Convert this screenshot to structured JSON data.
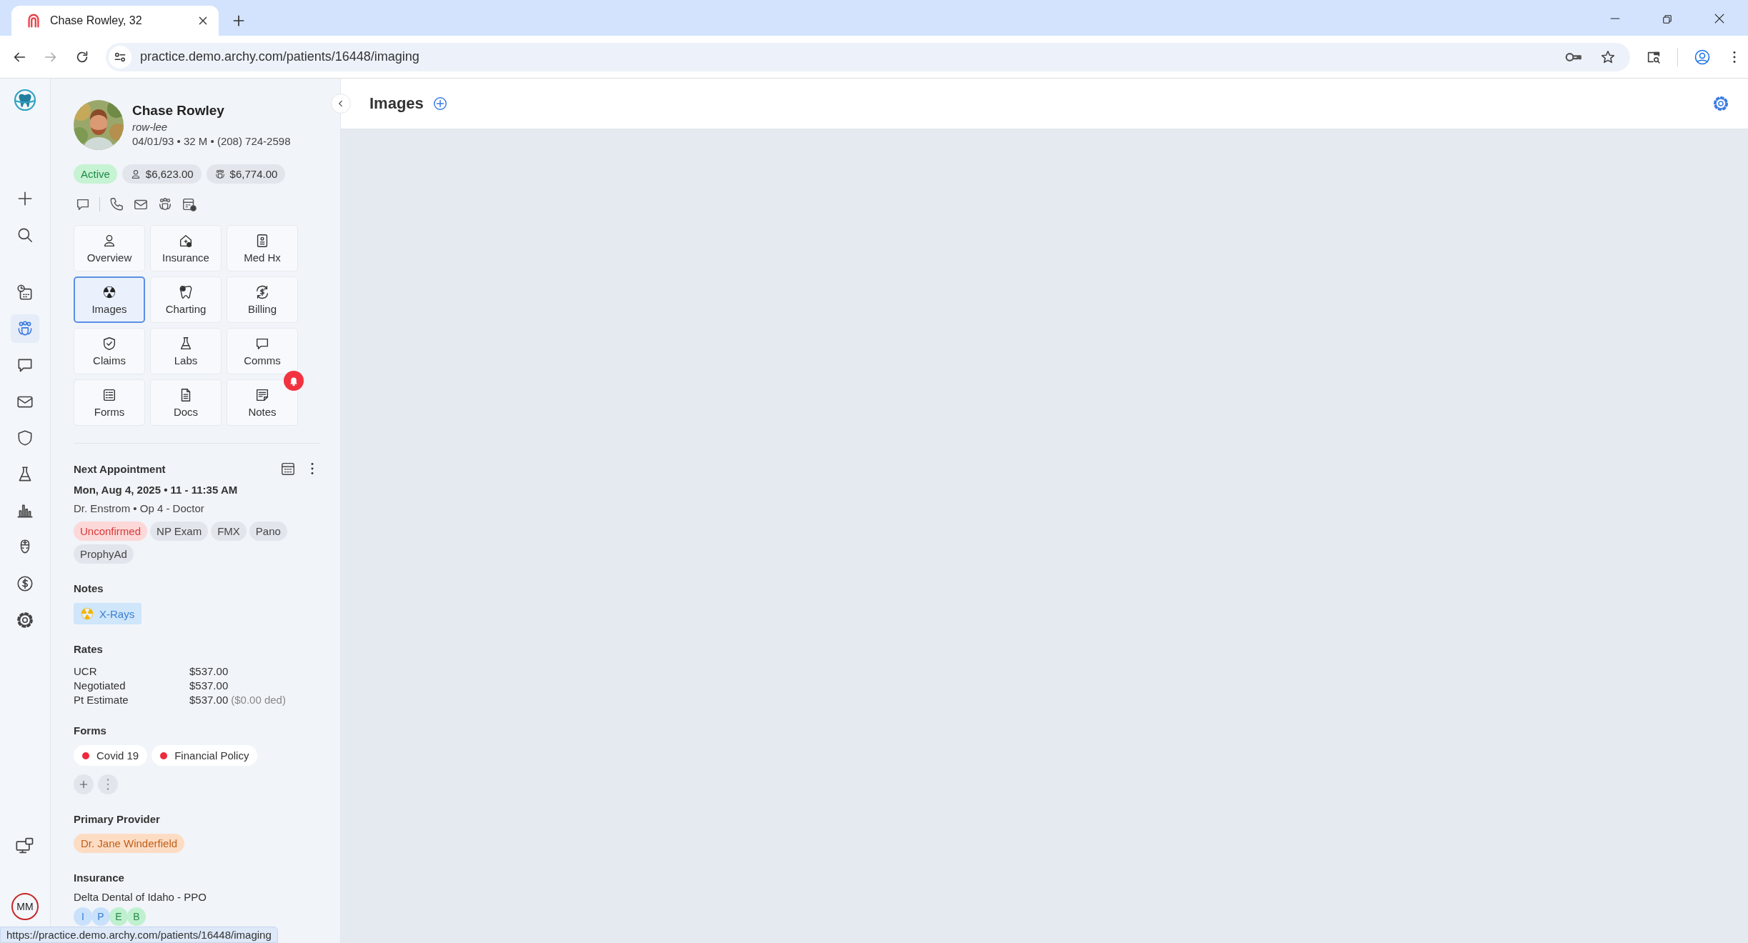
{
  "browser": {
    "tab_title": "Chase Rowley, 32",
    "url": "practice.demo.archy.com/patients/16448/imaging",
    "status_url": "https://practice.demo.archy.com/patients/16448/imaging"
  },
  "rail": {
    "items": [
      {
        "kind": "add",
        "selected": false
      },
      {
        "kind": "search",
        "selected": false
      },
      {
        "kind": "schedule",
        "selected": false
      },
      {
        "kind": "patients",
        "selected": true
      },
      {
        "kind": "chat",
        "selected": false
      },
      {
        "kind": "mail",
        "selected": false
      },
      {
        "kind": "shield",
        "selected": false
      },
      {
        "kind": "lab",
        "selected": false
      },
      {
        "kind": "reports",
        "selected": false
      },
      {
        "kind": "staff",
        "selected": false
      },
      {
        "kind": "billing",
        "selected": false
      },
      {
        "kind": "settings",
        "selected": false
      }
    ],
    "user_initials": "MM"
  },
  "patient": {
    "name": "Chase Rowley",
    "pronunciation": "row-lee",
    "details": "04/01/93 • 32 M • (208) 724-2598",
    "status": "Active",
    "balances": [
      {
        "kind": "patient",
        "amount": "$6,623.00"
      },
      {
        "kind": "family",
        "amount": "$6,774.00"
      }
    ],
    "tiles": [
      {
        "kind": "overview",
        "label": "Overview",
        "selected": false,
        "alert": false
      },
      {
        "kind": "insurance",
        "label": "Insurance",
        "selected": false,
        "alert": false
      },
      {
        "kind": "medhx",
        "label": "Med Hx",
        "selected": false,
        "alert": false
      },
      {
        "kind": "images",
        "label": "Images",
        "selected": true,
        "alert": false
      },
      {
        "kind": "charting",
        "label": "Charting",
        "selected": false,
        "alert": false
      },
      {
        "kind": "billing",
        "label": "Billing",
        "selected": false,
        "alert": false
      },
      {
        "kind": "claims",
        "label": "Claims",
        "selected": false,
        "alert": false
      },
      {
        "kind": "labs",
        "label": "Labs",
        "selected": false,
        "alert": false
      },
      {
        "kind": "comms",
        "label": "Comms",
        "selected": false,
        "alert": false
      },
      {
        "kind": "forms",
        "label": "Forms",
        "selected": false,
        "alert": false
      },
      {
        "kind": "docs",
        "label": "Docs",
        "selected": false,
        "alert": false
      },
      {
        "kind": "notes",
        "label": "Notes",
        "selected": false,
        "alert": true
      }
    ],
    "next_appointment": {
      "title": "Next Appointment",
      "date": "Mon, Aug 4, 2025 • 11 - 11:35 AM",
      "provider": "Dr. Enstrom • Op 4 - Doctor",
      "tags": [
        {
          "kind": "status",
          "label": "Unconfirmed"
        },
        {
          "kind": "procedure",
          "label": "NP Exam"
        },
        {
          "kind": "procedure",
          "label": "FMX"
        },
        {
          "kind": "procedure",
          "label": "Pano"
        },
        {
          "kind": "procedure",
          "label": "ProphyAd"
        }
      ]
    },
    "notes": {
      "title": "Notes",
      "items": [
        {
          "label": "X-Rays"
        }
      ]
    },
    "rates": {
      "title": "Rates",
      "rows": [
        {
          "label": "UCR",
          "value": "$537.00"
        },
        {
          "label": "Negotiated",
          "value": "$537.00"
        },
        {
          "label": "Pt Estimate",
          "value": "$537.00",
          "note": "($0.00 ded)"
        }
      ]
    },
    "forms": {
      "title": "Forms",
      "items": [
        {
          "label": "Covid 19",
          "color": "#ee2a3c"
        },
        {
          "label": "Financial Policy",
          "color": "#ee2a3c"
        }
      ]
    },
    "primary_provider": {
      "title": "Primary Provider",
      "name": "Dr. Jane Winderfield"
    },
    "insurance": {
      "title": "Insurance",
      "plan": "Delta Dental of Idaho - PPO",
      "badges": [
        {
          "letter": "I",
          "color": "#c9e1fb"
        },
        {
          "letter": "P",
          "color": "#c9e1fb"
        },
        {
          "letter": "E",
          "color": "#bff0cf"
        },
        {
          "letter": "B",
          "color": "#bff0cf"
        }
      ]
    }
  },
  "main": {
    "title": "Images"
  }
}
